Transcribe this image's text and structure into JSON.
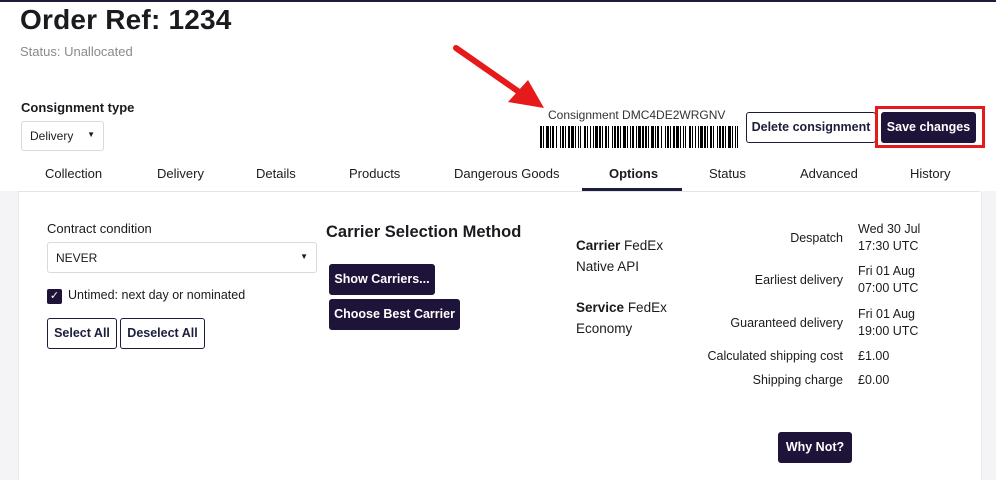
{
  "header": {
    "title": "Order Ref: 1234",
    "status": "Status: Unallocated"
  },
  "consignment_type": {
    "label": "Consignment type",
    "value": "Delivery"
  },
  "consignment": {
    "label": "Consignment DMC4DE2WRGNV"
  },
  "actions": {
    "delete": "Delete consignment",
    "save": "Save changes"
  },
  "tabs": [
    {
      "label": "Collection"
    },
    {
      "label": "Delivery"
    },
    {
      "label": "Details"
    },
    {
      "label": "Products"
    },
    {
      "label": "Dangerous Goods"
    },
    {
      "label": "Options",
      "active": true
    },
    {
      "label": "Status"
    },
    {
      "label": "Advanced"
    },
    {
      "label": "History"
    }
  ],
  "options": {
    "contract_condition": {
      "label": "Contract condition",
      "value": "NEVER"
    },
    "untimed": {
      "label": "Untimed: next day or nominated",
      "checked": true
    },
    "select_all": "Select All",
    "deselect_all": "Deselect All"
  },
  "carrier_selection": {
    "title": "Carrier Selection Method",
    "show_carriers": "Show Carriers...",
    "choose_best": "Choose Best Carrier"
  },
  "carrier_info": {
    "carrier_label": "Carrier",
    "carrier_value": "FedEx Native API",
    "service_label": "Service",
    "service_value": "FedEx Economy"
  },
  "shipping_info": {
    "despatch_label": "Despatch",
    "despatch_value": [
      "Wed 30 Jul",
      "17:30 UTC"
    ],
    "earliest_label": "Earliest delivery",
    "earliest_value": [
      "Fri 01 Aug",
      "07:00 UTC"
    ],
    "guaranteed_label": "Guaranteed delivery",
    "guaranteed_value": [
      "Fri 01 Aug",
      "19:00 UTC"
    ],
    "calc_cost_label": "Calculated shipping cost",
    "calc_cost_value": "£1.00",
    "charge_label": "Shipping charge",
    "charge_value": "£0.00"
  },
  "why_not": "Why Not?",
  "colors": {
    "primary_dark": "#1e1338",
    "highlight_red": "#e61a1a"
  }
}
